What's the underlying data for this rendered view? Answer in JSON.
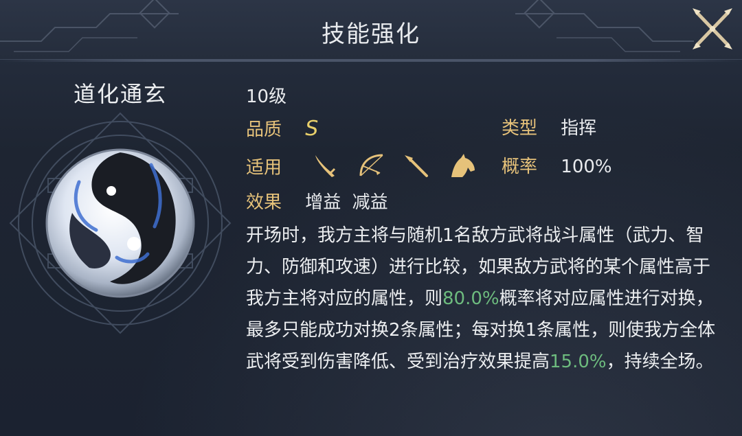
{
  "window": {
    "title": "技能强化"
  },
  "skill": {
    "name": "道化通玄",
    "level": "10级",
    "quality_label": "品质",
    "quality_value": "S",
    "type_label": "类型",
    "type_value": "指挥",
    "applies_label": "适用",
    "applies_icons": [
      "sword-icon",
      "bow-icon",
      "spear-icon",
      "horse-icon"
    ],
    "chance_label": "概率",
    "chance_value": "100%",
    "effect_label": "效果",
    "effect_values": [
      "增益",
      "减益"
    ],
    "description": {
      "part1": "开场时，我方主将与随机1名敌方武将战斗属性（武力、智力、防御和攻速）进行比较，如果敌方武将的某个属性高于我方主将对应的属性，则",
      "highlight1": "80.0%",
      "part2": "概率将对应属性进行对换，最多只能成功对换2条属性；每对换1条属性，则使我方全体武将受到伤害降低、受到治疗效果提高",
      "highlight2": "15.0%",
      "part3": "，持续全场。"
    }
  },
  "colors": {
    "label": "#e6c27a",
    "highlight": "#6dbb7e",
    "quality": "#e8cf6a",
    "icon": "#e6c27a"
  }
}
